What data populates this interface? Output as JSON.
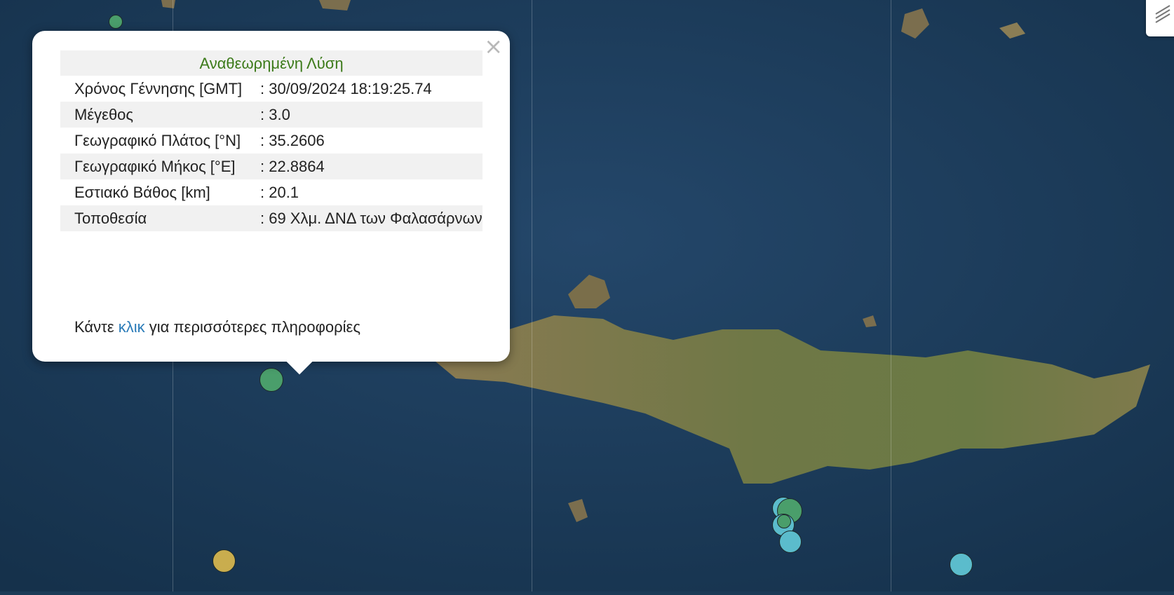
{
  "popup": {
    "title": "Αναθεωρημένη Λύση",
    "close_symbol": "×",
    "rows": [
      {
        "label": "Χρόνος Γέννησης [GMT]",
        "value": ": 30/09/2024 18:19:25.74"
      },
      {
        "label": "Μέγεθος",
        "value": ": 3.0"
      },
      {
        "label": "Γεωγραφικό Πλάτος [°N]",
        "value": ": 35.2606"
      },
      {
        "label": "Γεωγραφικό Μήκος [°E]",
        "value": ": 22.8864"
      },
      {
        "label": "Εστιακό Βάθος [km]",
        "value": ": 20.1"
      },
      {
        "label": "Τοποθεσία",
        "value": ": 69 Χλμ. ΔΝΔ των Φαλασάρνων"
      }
    ],
    "more_prefix": "Κάντε",
    "more_link": "κλικ",
    "more_suffix": "για περισσότερες πληροφορίες"
  },
  "colors": {
    "sea": "#1b3a56",
    "land": "#7d7550",
    "marker_green": "#4a9e6b",
    "marker_cyan": "#5bbccc",
    "marker_yellow": "#c9ad4e",
    "title_green": "#3c7a1a",
    "link_blue": "#2a7bb8"
  },
  "controls": {
    "layers": "layers-icon"
  }
}
